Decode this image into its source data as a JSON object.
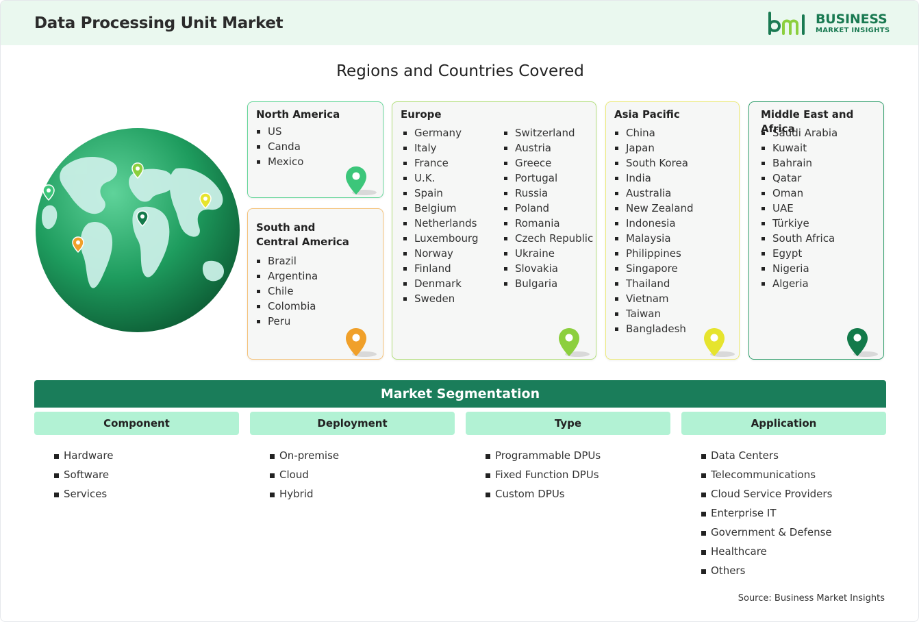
{
  "header": {
    "title": "Data Processing Unit Market",
    "logo_line1": "BUSINESS",
    "logo_line2": "MARKET INSIGHTS"
  },
  "regions_title": "Regions and Countries Covered",
  "regions": {
    "north_america": {
      "title": "North America",
      "color": "#3cc67a",
      "items": [
        "US",
        "Canda",
        "Mexico"
      ]
    },
    "south_america": {
      "title_line1": "South and",
      "title_line2": "Central America",
      "color": "#f0a02a",
      "items": [
        "Brazil",
        "Argentina",
        "Chile",
        "Colombia",
        "Peru"
      ]
    },
    "europe": {
      "title": "Europe",
      "color": "#8ccf3e",
      "col1": [
        "Germany",
        "Italy",
        "France",
        "U.K.",
        "Spain",
        "Belgium",
        "Netherlands",
        "Luxembourg",
        "Norway",
        "Finland",
        "Denmark",
        "Sweden"
      ],
      "col2": [
        "Switzerland",
        "Austria",
        "Greece",
        "Portugal",
        "Russia",
        "Poland",
        "Romania",
        "Czech Republic",
        "Ukraine",
        "Slovakia",
        "Bulgaria"
      ]
    },
    "asia_pacific": {
      "title": "Asia Pacific",
      "color": "#e6e42e",
      "items": [
        "China",
        "Japan",
        "South Korea",
        "India",
        "Australia",
        "New Zealand",
        "Indonesia",
        "Malaysia",
        "Philippines",
        "Singapore",
        "Thailand",
        "Vietnam",
        "Taiwan",
        "Bangladesh"
      ]
    },
    "middle_east_africa": {
      "title": "Middle East and Africa",
      "color": "#137a4a",
      "items": [
        "Saudi Arabia",
        "Kuwait",
        "Bahrain",
        "Qatar",
        "Oman",
        "UAE",
        "Türkiye",
        "South Africa",
        "Egypt",
        "Nigeria",
        "Algeria"
      ]
    }
  },
  "segmentation": {
    "title": "Market Segmentation",
    "columns": [
      {
        "head": "Component",
        "items": [
          "Hardware",
          "Software",
          "Services"
        ]
      },
      {
        "head": "Deployment",
        "items": [
          "On-premise",
          "Cloud",
          "Hybrid"
        ]
      },
      {
        "head": "Type",
        "items": [
          "Programmable DPUs",
          "Fixed Function DPUs",
          "Custom DPUs"
        ]
      },
      {
        "head": "Application",
        "items": [
          "Data Centers",
          "Telecommunications",
          "Cloud Service Providers",
          "Enterprise IT",
          "Government & Defense",
          "Healthcare",
          "Others"
        ]
      }
    ]
  },
  "source": "Source: Business Market Insights",
  "icons": {
    "globe": "globe-icon",
    "pin": "map-pin-icon",
    "logo": "bmi-logo-icon"
  }
}
